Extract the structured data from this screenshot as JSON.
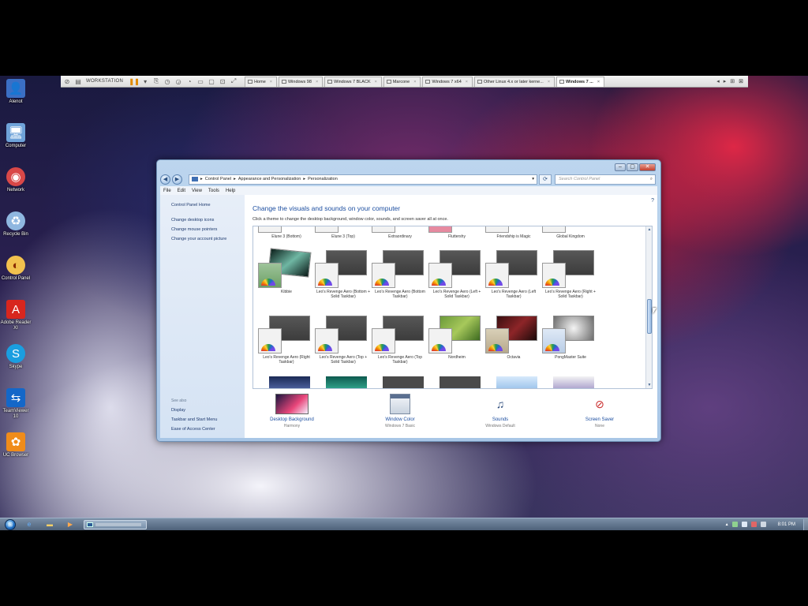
{
  "vm_toolbar": {
    "brand": "WORKSTATION",
    "tabs": [
      {
        "label": "Home",
        "active": false
      },
      {
        "label": "Windows 98",
        "active": false
      },
      {
        "label": "Windows 7 BLACK",
        "active": false
      },
      {
        "label": "Marcone",
        "active": false
      },
      {
        "label": "Windows 7 x64",
        "active": false
      },
      {
        "label": "Other Linux 4.x or later kerne...",
        "active": false
      },
      {
        "label": "Windows 7 ...",
        "active": true
      }
    ]
  },
  "desktop_icons": [
    {
      "label": "Alenot",
      "icon": "user-folder-icon",
      "color": "#3b6fc4"
    },
    {
      "label": "Computer",
      "icon": "computer-icon",
      "color": "#6fa3d9"
    },
    {
      "label": "Network",
      "icon": "network-icon",
      "color": "#d94848"
    },
    {
      "label": "Recycle Bin",
      "icon": "recycle-bin-icon",
      "color": "#8fb7e0"
    },
    {
      "label": "Control Panel",
      "icon": "control-panel-icon",
      "color": "#f2c14e"
    },
    {
      "label": "Adobe Reader XI",
      "icon": "adobe-reader-icon",
      "color": "#d8261e"
    },
    {
      "label": "Skype",
      "icon": "skype-icon",
      "color": "#1a9ee0"
    },
    {
      "label": "TeamViewer 10",
      "icon": "teamviewer-icon",
      "color": "#1467c8"
    },
    {
      "label": "UC Browser",
      "icon": "uc-browser-icon",
      "color": "#f08c1a"
    }
  ],
  "window": {
    "breadcrumb": [
      "Control Panel",
      "Appearance and Personalization",
      "Personalization"
    ],
    "search_placeholder": "Search Control Panel",
    "menu": [
      "File",
      "Edit",
      "View",
      "Tools",
      "Help"
    ],
    "left_pane": {
      "home_link": "Control Panel Home",
      "links": [
        "Change desktop icons",
        "Change mouse pointers",
        "Change your account picture"
      ],
      "see_also_heading": "See also",
      "see_also_links": [
        "Display",
        "Taskbar and Start Menu",
        "Ease of Access Center"
      ]
    },
    "title": "Change the visuals and sounds on your computer",
    "subtitle": "Click a theme to change the desktop background, window color, sounds, and screen saver all at once.",
    "themes_top_partial": [
      "Elune 3 (Bottom)",
      "Elune 3 (Top)",
      "Extraordinary",
      "Fluttershy",
      "Friendship is Magic",
      "Global Kingdom"
    ],
    "themes_row1": [
      "Kibbie",
      "Leo's Revenge Aero (Bottom + Solid Taskbar)",
      "Leo's Revenge Aero (Bottom Taskbar)",
      "Leo's Revenge Aero (Left + Solid Taskbar)",
      "Leo's Revenge Aero (Left Taskbar)",
      "Leo's Revenge Aero (Right + Solid Taskbar)"
    ],
    "themes_row2": [
      "Leo's Revenge Aero (Right Taskbar)",
      "Leo's Revenge Aero (Top + Solid Taskbar)",
      "Leo's Revenge Aero (Top Taskbar)",
      "Nordheim",
      "Octavia",
      "PongMaster Suite"
    ],
    "bottom": [
      {
        "label": "Desktop Background",
        "sub": "Harmony",
        "icon": "desktop-background-icon"
      },
      {
        "label": "Window Color",
        "sub": "Windows 7 Basic",
        "icon": "window-color-icon"
      },
      {
        "label": "Sounds",
        "sub": "Windows Default",
        "icon": "sounds-icon"
      },
      {
        "label": "Screen Saver",
        "sub": "None",
        "icon": "screen-saver-icon"
      }
    ]
  },
  "taskbar": {
    "clock": "8:01 PM"
  }
}
